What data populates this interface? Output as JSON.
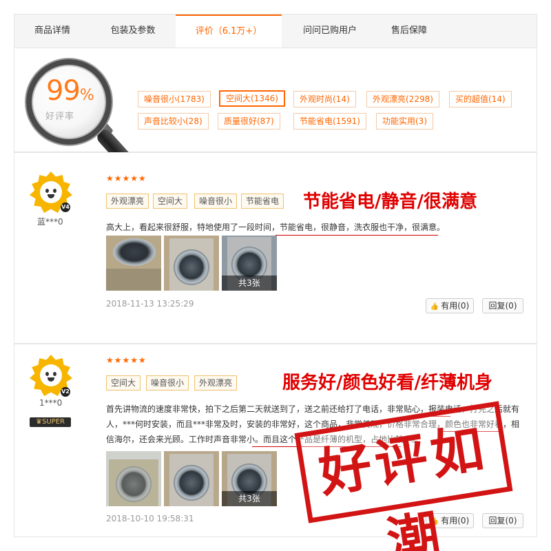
{
  "tabs": [
    {
      "label": "商品详情"
    },
    {
      "label": "包装及参数"
    },
    {
      "label": "评价（6.1万+）"
    },
    {
      "label": "问问已购用户"
    },
    {
      "label": "售后保障"
    }
  ],
  "summary": {
    "rate_value": "99",
    "rate_unit": "%",
    "rate_label": "好评率",
    "tags": [
      {
        "label": "噪音很小(1783)",
        "selected": false
      },
      {
        "label": "空间大(1346)",
        "selected": true
      },
      {
        "label": "外观时尚(14)",
        "selected": false
      },
      {
        "label": "外观漂亮(2298)",
        "selected": false
      },
      {
        "label": "买的超值(14)",
        "selected": false
      },
      {
        "label": "声音比较小(28)",
        "selected": false
      },
      {
        "label": "质量很好(87)",
        "selected": false
      },
      {
        "label": "节能省电(1591)",
        "selected": false
      },
      {
        "label": "功能实用(3)",
        "selected": false
      }
    ]
  },
  "reviews": [
    {
      "user": "蓝***0",
      "level": "V4",
      "rating": 5,
      "stars": "★★★★★",
      "tags": [
        "外观漂亮",
        "空间大",
        "噪音很小",
        "节能省电"
      ],
      "headline": "节能省电/静音/很满意",
      "text": "高大上，看起来很舒服，特地使用了一段时间，节能省电，很静音，洗衣服也干净，很满意。",
      "photo_count_label": "共3张",
      "date": "2018-11-13 13:25:29",
      "useful_label": "有用(0)",
      "reply_label": "回复(0)"
    },
    {
      "user": "1***0",
      "level": "V2",
      "member_badge": "SUPER",
      "rating": 5,
      "stars": "★★★★★",
      "tags": [
        "空间大",
        "噪音很小",
        "外观漂亮"
      ],
      "headline": "服务好/颜色好看/纤薄机身",
      "text": "首先讲物流的速度非常快，拍下之后第二天就送到了，送之前还给打了电话，非常贴心，报装电话，打完之后就有人，***何时安装，而且***非常及时，安装的非常好，这个商品，非常美观，价格非常合理，颜色也非常好看，相信海尔，还会来光顾。工作时声音非常小。而且这个产品是纤薄的机型，占地比较小。",
      "photo_count_label": "共3张",
      "date": "2018-10-10 19:58:31",
      "useful_label": "有用(0)",
      "reply_label": "回复(0)"
    }
  ],
  "overlay_stamp": "好评如潮",
  "colors": {
    "accent": "#ff6600",
    "headline_red": "#e00000",
    "stamp_red": "#d21414"
  }
}
